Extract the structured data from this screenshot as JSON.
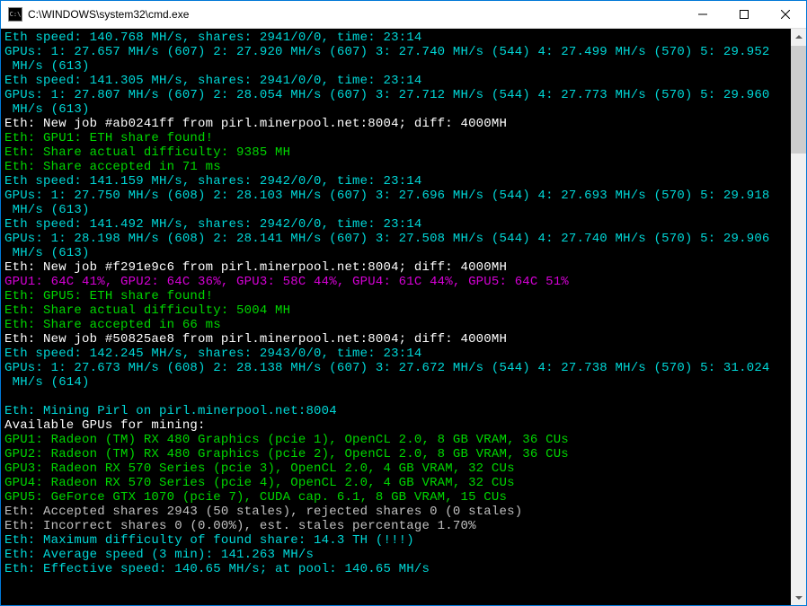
{
  "window": {
    "title": "C:\\WINDOWS\\system32\\cmd.exe",
    "icon": "cmd"
  },
  "lines": [
    {
      "segs": [
        {
          "c": "cyan",
          "t": "Eth speed: 140.768 MH/s, shares: 2941/0/0, time: 23:14"
        }
      ]
    },
    {
      "segs": [
        {
          "c": "cyan",
          "t": "GPUs: 1: 27.657 MH/s (607) 2: 27.920 MH/s (607) 3: 27.740 MH/s (544) 4: 27.499 MH/s (570) 5: 29.952 MH/s (613)"
        }
      ]
    },
    {
      "segs": [
        {
          "c": "cyan",
          "t": "Eth speed: 141.305 MH/s, shares: 2941/0/0, time: 23:14"
        }
      ]
    },
    {
      "segs": [
        {
          "c": "cyan",
          "t": "GPUs: 1: 27.807 MH/s (607) 2: 28.054 MH/s (607) 3: 27.712 MH/s (544) 4: 27.773 MH/s (570) 5: 29.960 MH/s (613)"
        }
      ]
    },
    {
      "segs": [
        {
          "c": "white",
          "t": "Eth: New job #ab0241ff from pirl.minerpool.net:8004; diff: 4000MH"
        }
      ]
    },
    {
      "segs": [
        {
          "c": "green",
          "t": "Eth: GPU1: ETH share found!"
        }
      ]
    },
    {
      "segs": [
        {
          "c": "green",
          "t": "Eth: Share actual difficulty: 9385 MH"
        }
      ]
    },
    {
      "segs": [
        {
          "c": "green",
          "t": "Eth: Share accepted in 71 ms"
        }
      ]
    },
    {
      "segs": [
        {
          "c": "cyan",
          "t": "Eth speed: 141.159 MH/s, shares: 2942/0/0, time: 23:14"
        }
      ]
    },
    {
      "segs": [
        {
          "c": "cyan",
          "t": "GPUs: 1: 27.750 MH/s (608) 2: 28.103 MH/s (607) 3: 27.696 MH/s (544) 4: 27.693 MH/s (570) 5: 29.918 MH/s (613)"
        }
      ]
    },
    {
      "segs": [
        {
          "c": "cyan",
          "t": "Eth speed: 141.492 MH/s, shares: 2942/0/0, time: 23:14"
        }
      ]
    },
    {
      "segs": [
        {
          "c": "cyan",
          "t": "GPUs: 1: 28.198 MH/s (608) 2: 28.141 MH/s (607) 3: 27.508 MH/s (544) 4: 27.740 MH/s (570) 5: 29.906 MH/s (613)"
        }
      ]
    },
    {
      "segs": [
        {
          "c": "white",
          "t": "Eth: New job #f291e9c6 from pirl.minerpool.net:8004; diff: 4000MH"
        }
      ]
    },
    {
      "segs": [
        {
          "c": "magenta",
          "t": "GPU1: 64C 41%, GPU2: 64C 36%, GPU3: 58C 44%, GPU4: 61C 44%, GPU5: 64C 51%"
        }
      ]
    },
    {
      "segs": [
        {
          "c": "green",
          "t": "Eth: GPU5: ETH share found!"
        }
      ]
    },
    {
      "segs": [
        {
          "c": "green",
          "t": "Eth: Share actual difficulty: 5004 MH"
        }
      ]
    },
    {
      "segs": [
        {
          "c": "green",
          "t": "Eth: Share accepted in 66 ms"
        }
      ]
    },
    {
      "segs": [
        {
          "c": "white",
          "t": "Eth: New job #50825ae8 from pirl.minerpool.net:8004; diff: 4000MH"
        }
      ]
    },
    {
      "segs": [
        {
          "c": "cyan",
          "t": "Eth speed: 142.245 MH/s, shares: 2943/0/0, time: 23:14"
        }
      ]
    },
    {
      "segs": [
        {
          "c": "cyan",
          "t": "GPUs: 1: 27.673 MH/s (608) 2: 28.138 MH/s (607) 3: 27.672 MH/s (544) 4: 27.738 MH/s (570) 5: 31.024 MH/s (614)"
        }
      ]
    },
    {
      "segs": [
        {
          "c": "gray",
          "t": " "
        }
      ]
    },
    {
      "segs": [
        {
          "c": "cyan",
          "t": "Eth: Mining Pirl on pirl.minerpool.net:8004"
        }
      ]
    },
    {
      "segs": [
        {
          "c": "white",
          "t": "Available GPUs for mining:"
        }
      ]
    },
    {
      "segs": [
        {
          "c": "green",
          "t": "GPU1: Radeon (TM) RX 480 Graphics (pcie 1), OpenCL 2.0, 8 GB VRAM, 36 CUs"
        }
      ]
    },
    {
      "segs": [
        {
          "c": "green",
          "t": "GPU2: Radeon (TM) RX 480 Graphics (pcie 2), OpenCL 2.0, 8 GB VRAM, 36 CUs"
        }
      ]
    },
    {
      "segs": [
        {
          "c": "green",
          "t": "GPU3: Radeon RX 570 Series (pcie 3), OpenCL 2.0, 4 GB VRAM, 32 CUs"
        }
      ]
    },
    {
      "segs": [
        {
          "c": "green",
          "t": "GPU4: Radeon RX 570 Series (pcie 4), OpenCL 2.0, 4 GB VRAM, 32 CUs"
        }
      ]
    },
    {
      "segs": [
        {
          "c": "green",
          "t": "GPU5: GeForce GTX 1070 (pcie 7), CUDA cap. 6.1, 8 GB VRAM, 15 CUs"
        }
      ]
    },
    {
      "segs": [
        {
          "c": "gray",
          "t": "Eth: Accepted shares 2943 (50 stales), rejected shares 0 (0 stales)"
        }
      ]
    },
    {
      "segs": [
        {
          "c": "gray",
          "t": "Eth: Incorrect shares 0 (0.00%), est. stales percentage 1.70%"
        }
      ]
    },
    {
      "segs": [
        {
          "c": "cyan",
          "t": "Eth: Maximum difficulty of found share: 14.3 TH (!!!)"
        }
      ]
    },
    {
      "segs": [
        {
          "c": "cyan",
          "t": "Eth: Average speed (3 min): 141.263 MH/s"
        }
      ]
    },
    {
      "segs": [
        {
          "c": "cyan",
          "t": "Eth: Effective speed: 140.65 MH/s; at pool: 140.65 MH/s"
        }
      ]
    }
  ]
}
